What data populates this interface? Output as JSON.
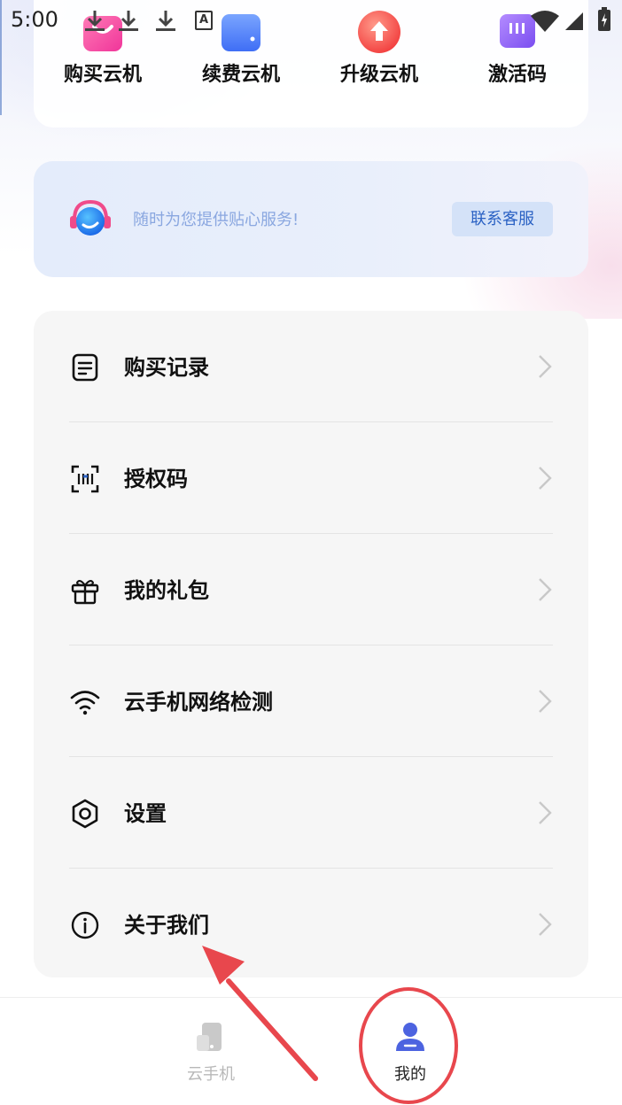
{
  "status_bar": {
    "time": "5:00",
    "icons": [
      "download-icon",
      "download-icon",
      "download-icon",
      "a-badge-icon",
      "wifi-icon",
      "signal-icon",
      "battery-charging-icon"
    ],
    "a_badge": "A"
  },
  "quick_actions": [
    {
      "label": "购买云机",
      "icon": "shopping-bag-icon"
    },
    {
      "label": "续费云机",
      "icon": "wallet-icon"
    },
    {
      "label": "升级云机",
      "icon": "upgrade-arrow-icon"
    },
    {
      "label": "激活码",
      "icon": "ticket-icon"
    }
  ],
  "service": {
    "text": "随时为您提供贴心服务!",
    "button": "联系客服",
    "icon": "headset-icon"
  },
  "menu": [
    {
      "label": "购买记录",
      "icon": "document-icon"
    },
    {
      "label": "授权码",
      "icon": "barcode-scan-icon"
    },
    {
      "label": "我的礼包",
      "icon": "gift-icon"
    },
    {
      "label": "云手机网络检测",
      "icon": "wifi-icon"
    },
    {
      "label": "设置",
      "icon": "gear-icon"
    },
    {
      "label": "关于我们",
      "icon": "info-icon"
    }
  ],
  "bottom_nav": {
    "tabs": [
      {
        "label": "云手机",
        "icon": "phone-icon",
        "active": false
      },
      {
        "label": "我的",
        "icon": "user-icon",
        "active": true
      }
    ]
  },
  "colors": {
    "accent": "#2b62c4",
    "service_text": "#8aa7e0",
    "annotation": "#e8474d",
    "nav_active": "#3b5bdb"
  }
}
